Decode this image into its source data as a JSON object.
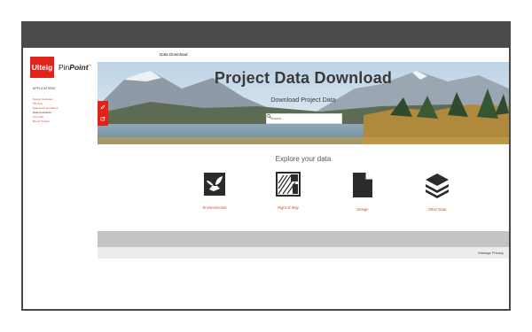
{
  "sidebar": {
    "logo_brand": "Ulteig",
    "logo_product_prefix": "Pin",
    "logo_product_suffix": "Point",
    "logo_trademark": "™",
    "apps_heading": "APPLICATIONS",
    "items": [
      {
        "label": "Design Reviewer",
        "active": false
      },
      {
        "label": "TB View",
        "active": false
      },
      {
        "label": "Easement Conditions",
        "active": false
      },
      {
        "label": "Data Download",
        "active": true
      },
      {
        "label": "Geo Hub",
        "active": false
      },
      {
        "label": "Bionic Tracker",
        "active": false
      }
    ]
  },
  "topbar": {
    "title": "Data Download"
  },
  "hero": {
    "title": "Project Data Download",
    "subtitle": "Download Project Data",
    "search_placeholder": "Search..."
  },
  "explore": {
    "title": "Explore your data",
    "tiles": [
      {
        "label": "Environmental",
        "icon": "environmental-icon"
      },
      {
        "label": "Right of Way",
        "icon": "right-of-way-icon"
      },
      {
        "label": "Design",
        "icon": "design-document-icon"
      },
      {
        "label": "Other Data",
        "icon": "layers-icon"
      }
    ]
  },
  "footer": {
    "links": "Manage Privacy"
  },
  "colors": {
    "accent": "#e2231a",
    "link": "#d9482b",
    "chrome": "#4a4a4a",
    "band": "#c4c4c4"
  }
}
